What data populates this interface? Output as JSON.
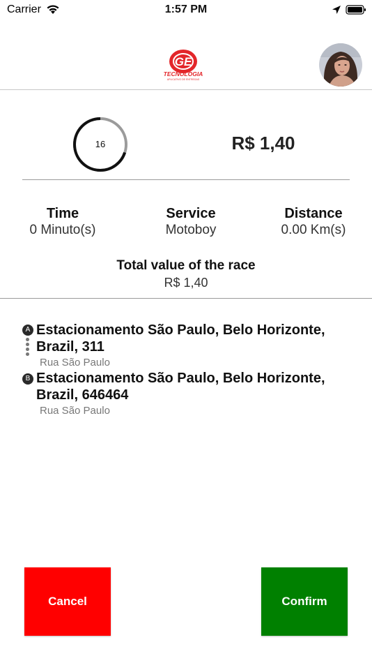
{
  "status_bar": {
    "carrier": "Carrier",
    "time": "1:57 PM",
    "icons": [
      "wifi-icon",
      "location-arrow-icon",
      "battery-icon"
    ]
  },
  "header": {
    "logo_text": "TECNOLOGIA",
    "logo_subtext": "APLICATIVO DE ENTREGAS",
    "logo_initials": "GE",
    "avatar": "user-avatar"
  },
  "timer": {
    "value": "16",
    "progress": 0.3
  },
  "price": "R$ 1,40",
  "info": {
    "time_title": "Time",
    "time_value": "0 Minuto(s)",
    "service_title": "Service",
    "service_value": "Motoboy",
    "distance_title": "Distance",
    "distance_value": "0.00 Km(s)"
  },
  "total": {
    "title": "Total value of the race",
    "value": "R$ 1,40"
  },
  "route": {
    "origin": {
      "marker": "A",
      "address": "Estacionamento São Paulo, Belo Horizonte, Brazil, 311",
      "street": "Rua São Paulo"
    },
    "destination": {
      "marker": "B",
      "address": "Estacionamento São Paulo, Belo Horizonte, Brazil, 646464",
      "street": "Rua São Paulo"
    }
  },
  "actions": {
    "cancel_label": "Cancel",
    "confirm_label": "Confirm"
  },
  "colors": {
    "cancel": "#ff0000",
    "confirm": "#008000",
    "logo_red": "#e3262a",
    "timer_track": "#9b9b9b",
    "timer_progress": "#111111"
  }
}
